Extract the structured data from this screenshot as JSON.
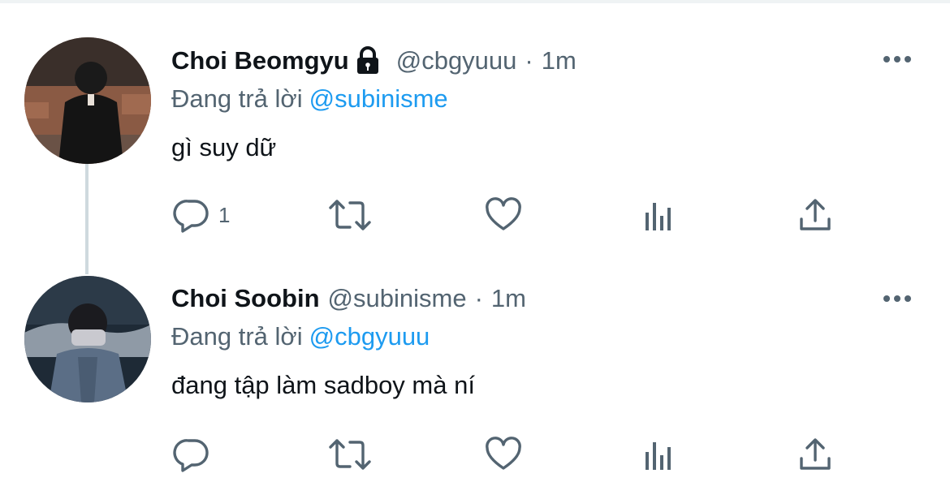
{
  "tweets": [
    {
      "author_name": "Choi Beomgyu",
      "protected_icon": "lock-icon",
      "handle": "@cbgyuuu",
      "separator": "·",
      "time": "1m",
      "replying_prefix": "Đang trả lời",
      "replying_to": "@subinisme",
      "text": "gì suy dữ",
      "reply_count": "1"
    },
    {
      "author_name": "Choi Soobin",
      "handle": "@subinisme",
      "separator": "·",
      "time": "1m",
      "replying_prefix": "Đang trả lời",
      "replying_to": "@cbgyuuu",
      "text": "đang tập làm sadboy mà ní",
      "reply_count": ""
    }
  ],
  "icons": {
    "more": "more-horizontal-icon",
    "reply": "reply-icon",
    "retweet": "retweet-icon",
    "like": "heart-icon",
    "views": "analytics-icon",
    "share": "share-icon"
  },
  "colors": {
    "text_primary": "#0f1419",
    "text_secondary": "#536471",
    "accent": "#1d9bf0",
    "thread_line": "#cfd9de"
  }
}
